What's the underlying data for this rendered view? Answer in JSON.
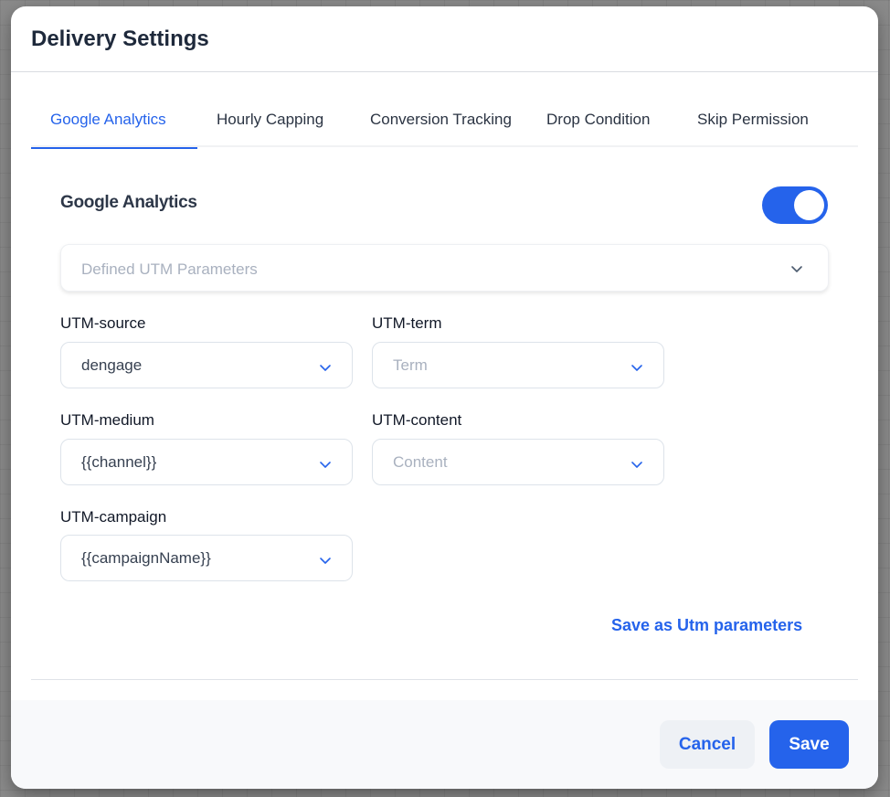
{
  "modal": {
    "title": "Delivery Settings"
  },
  "tabs": [
    {
      "label": "Google Analytics",
      "active": true
    },
    {
      "label": "Hourly Capping",
      "active": false
    },
    {
      "label": "Conversion Tracking",
      "active": false
    },
    {
      "label": "Drop Condition",
      "active": false
    },
    {
      "label": "Skip Permission",
      "active": false
    }
  ],
  "google_analytics": {
    "section_title": "Google Analytics",
    "enabled": true,
    "defined_utm_placeholder": "Defined UTM Parameters",
    "fields": {
      "utm_source": {
        "label": "UTM-source",
        "value": "dengage",
        "placeholder": ""
      },
      "utm_term": {
        "label": "UTM-term",
        "value": "",
        "placeholder": "Term"
      },
      "utm_medium": {
        "label": "UTM-medium",
        "value": "{{channel}}",
        "placeholder": ""
      },
      "utm_content": {
        "label": "UTM-content",
        "value": "",
        "placeholder": "Content"
      },
      "utm_campaign": {
        "label": "UTM-campaign",
        "value": "{{campaignName}}",
        "placeholder": ""
      }
    },
    "save_link": "Save as Utm parameters"
  },
  "footer": {
    "cancel_label": "Cancel",
    "save_label": "Save"
  },
  "icons": {
    "select_chevron": "chevron-down-icon"
  },
  "colors": {
    "accent": "#2563eb",
    "title": "#1e293b",
    "placeholder": "#a9b1bf",
    "footer_bg": "#f8f9fb",
    "cancel_bg": "#eef1f5"
  }
}
